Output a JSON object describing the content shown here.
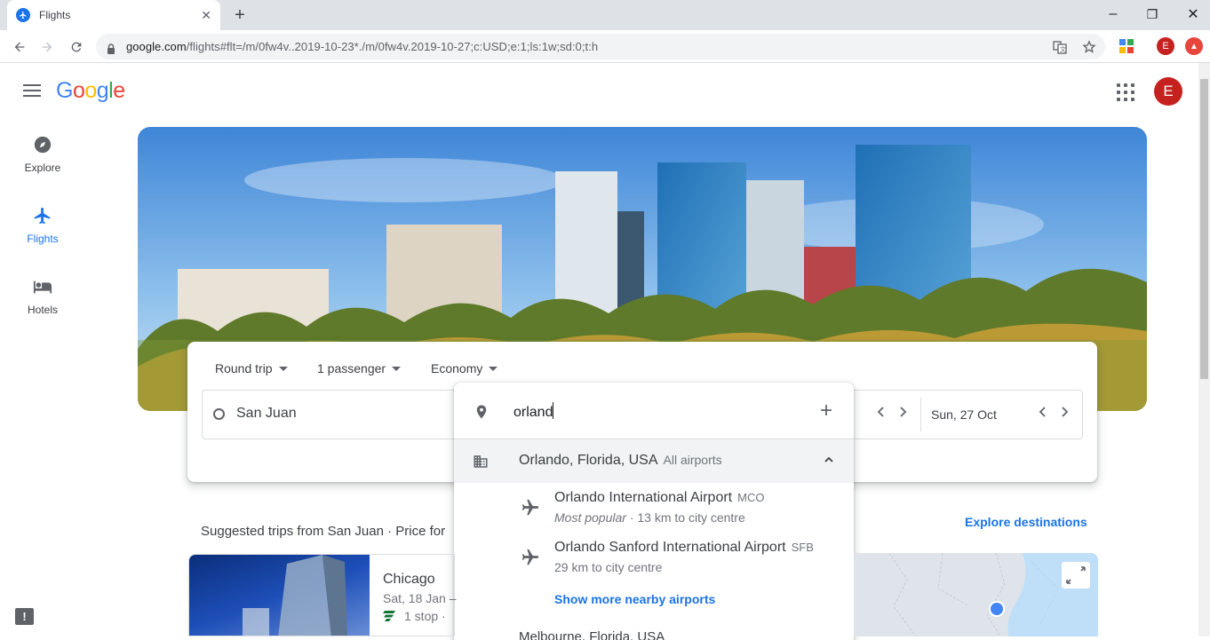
{
  "browser": {
    "tab_title": "Flights",
    "tab_close": "✕",
    "new_tab": "+",
    "url_host": "google.com",
    "url_path": "/flights#flt=/m/0fw4v..2019-10-23*./m/0fw4v.2019-10-27;c:USD;e:1;ls:1w;sd:0;t:h",
    "window_controls": [
      "–",
      "❐",
      "✕"
    ],
    "profile_initial": "E"
  },
  "header": {
    "logo_letters": [
      "G",
      "o",
      "o",
      "g",
      "l",
      "e"
    ],
    "logo_colors": [
      "#4285f4",
      "#ea4335",
      "#fbbc05",
      "#4285f4",
      "#34a853",
      "#ea4335"
    ],
    "avatar_initial": "E"
  },
  "sidenav": {
    "items": [
      {
        "label": "Explore",
        "icon": "compass-icon"
      },
      {
        "label": "Flights",
        "icon": "airplane-icon",
        "active": true
      },
      {
        "label": "Hotels",
        "icon": "bed-icon"
      }
    ]
  },
  "search": {
    "trip_type": "Round trip",
    "passengers": "1 passenger",
    "cabin": "Economy",
    "origin": "San Juan",
    "return_date": "Sun, 27 Oct"
  },
  "dropdown": {
    "query": "orland",
    "city": {
      "name": "Orlando, Florida, USA",
      "sub": "All airports"
    },
    "airports": [
      {
        "name": "Orlando International Airport",
        "code": "MCO",
        "highlight": "Most popular",
        "meta": " · 13 km to city centre"
      },
      {
        "name": "Orlando Sanford International Airport",
        "code": "SFB",
        "highlight": "",
        "meta": "29 km to city centre"
      }
    ],
    "more_link": "Show more nearby airports",
    "next_item": "Melbourne, Florida, USA"
  },
  "suggested": {
    "title": "Suggested trips from San Juan · Price for",
    "explore_link": "Explore destinations",
    "trip": {
      "city": "Chicago",
      "dates": "Sat, 18 Jan –",
      "stops": "1 stop ·"
    }
  },
  "colors": {
    "accent": "#1a73e8",
    "avatar": "#c5221f"
  }
}
